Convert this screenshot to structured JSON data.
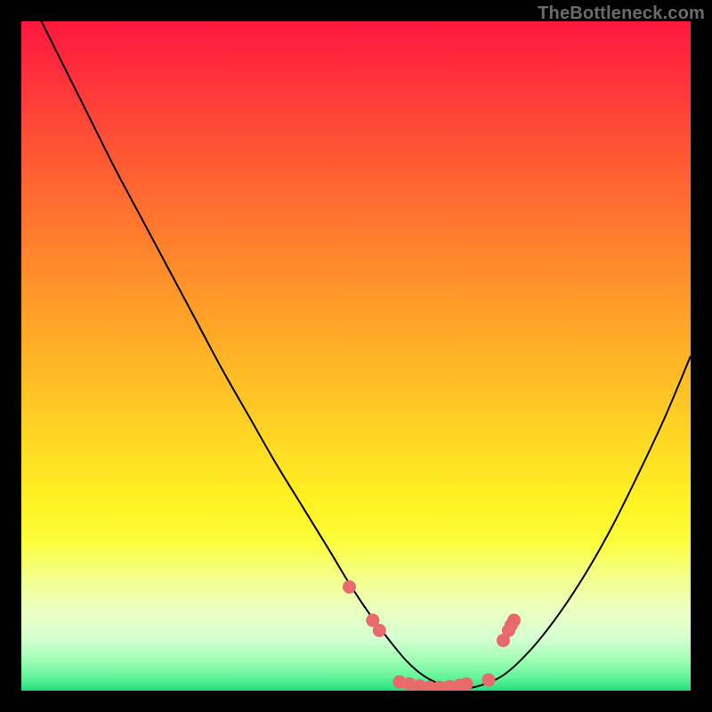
{
  "watermark": "TheBottleneck.com",
  "colors": {
    "background": "#000000",
    "curve_stroke": "#000000",
    "marker_fill": "#e96a6d",
    "marker_stroke": "#d95459"
  },
  "chart_data": {
    "type": "line",
    "title": "",
    "xlabel": "",
    "ylabel": "",
    "xlim": [
      0,
      100
    ],
    "ylim": [
      0,
      100
    ],
    "grid": false,
    "series": [
      {
        "name": "bottleneck-curve",
        "x": [
          3,
          6,
          10,
          14,
          18,
          22,
          26,
          30,
          34,
          38,
          42,
          46,
          49,
          52,
          55,
          57.5,
          60,
          62.5,
          65,
          68,
          72,
          76,
          80,
          84,
          88,
          92,
          96,
          100
        ],
        "y": [
          100,
          94,
          86,
          78,
          70.5,
          63,
          55.5,
          48,
          41,
          34,
          27.5,
          21,
          16,
          11.5,
          7.5,
          4.5,
          2.3,
          1.0,
          0.4,
          0.6,
          2.3,
          6.0,
          11,
          17,
          24,
          32,
          40.5,
          50
        ]
      }
    ],
    "markers": [
      {
        "x": 49.0,
        "y": 15.5
      },
      {
        "x": 52.5,
        "y": 10.5
      },
      {
        "x": 53.5,
        "y": 9.0
      },
      {
        "x": 56.5,
        "y": 1.3
      },
      {
        "x": 58.0,
        "y": 1.0
      },
      {
        "x": 59.5,
        "y": 0.7
      },
      {
        "x": 61.0,
        "y": 0.5
      },
      {
        "x": 62.5,
        "y": 0.5
      },
      {
        "x": 64.0,
        "y": 0.6
      },
      {
        "x": 65.5,
        "y": 0.8
      },
      {
        "x": 66.5,
        "y": 1.0
      },
      {
        "x": 69.8,
        "y": 1.6
      },
      {
        "x": 72.0,
        "y": 7.5
      },
      {
        "x": 72.8,
        "y": 9.0
      },
      {
        "x": 73.2,
        "y": 9.8
      },
      {
        "x": 73.6,
        "y": 10.5
      }
    ]
  }
}
